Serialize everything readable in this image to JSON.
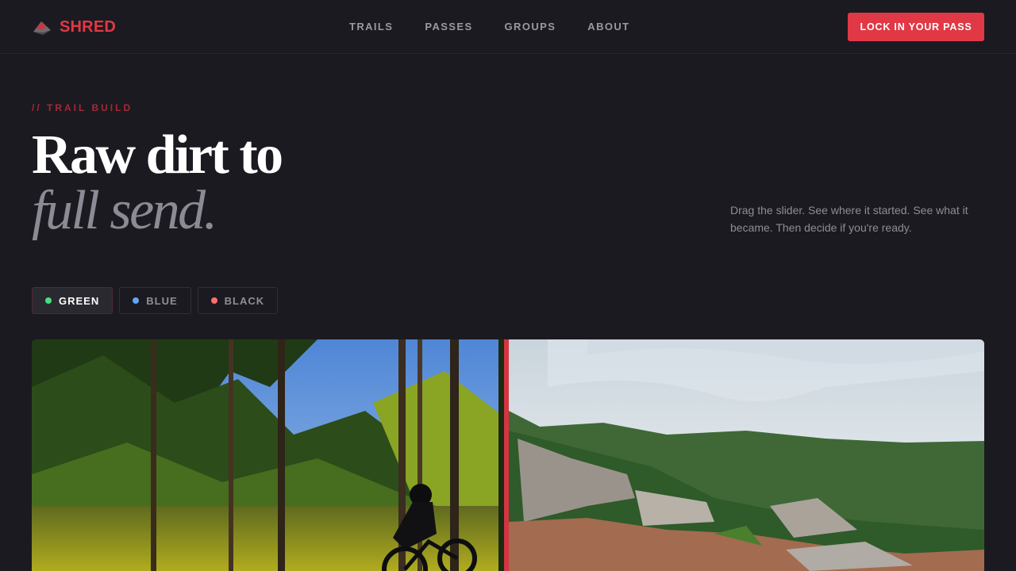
{
  "brand": {
    "name": "SHRED",
    "logo_icon": "mountain-icon",
    "accent": "#e13845"
  },
  "nav": {
    "items": [
      "TRAILS",
      "PASSES",
      "GROUPS",
      "ABOUT"
    ],
    "cta": "LOCK IN YOUR PASS"
  },
  "hero": {
    "eyebrow": "// TRAIL BUILD",
    "title_line1": "Raw dirt to",
    "title_line2": "full send.",
    "description": "Drag the slider. See where it started. See what it became. Then decide if you're ready."
  },
  "filters": [
    {
      "label": "GREEN",
      "color": "#4ade80",
      "active": true
    },
    {
      "label": "BLUE",
      "color": "#60a5fa",
      "active": false
    },
    {
      "label": "BLACK",
      "color": "#f87171",
      "active": false
    }
  ],
  "comparison": {
    "after_image": "rider-in-forest-image",
    "before_image": "cleared-hillside-image",
    "slider_position": 0.5
  }
}
